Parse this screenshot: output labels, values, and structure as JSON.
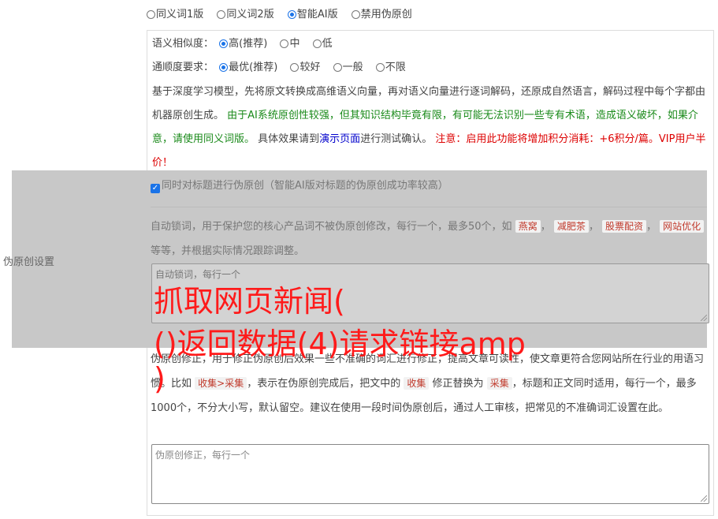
{
  "versions": {
    "selected": "智能AI版",
    "options": [
      "同义词1版",
      "同义词2版",
      "智能AI版",
      "禁用伪原创"
    ]
  },
  "similarity": {
    "label": "语义相似度：",
    "options": [
      "高(推荐)",
      "中",
      "低"
    ],
    "selected": "高(推荐)"
  },
  "fluency": {
    "label": "通顺度要求：",
    "options": [
      "最优(推荐)",
      "较好",
      "一般",
      "不限"
    ],
    "selected": "最优(推荐)"
  },
  "description": {
    "part1": "基于深度学习模型，先将原文转换成高维语义向量，再对语义向量进行逐词解码，还原成自然语言，解码过程中每个字都由机器原创生成。",
    "part2_green": "由于AI系统原创性较强，但其知识结构毕竟有限，有可能无法识别一些专有术语，造成语义破坏，如果介意，请使用同义词版。",
    "part3": "具体效果请到",
    "link": "演示页面",
    "part4": "进行测试确认。",
    "warning_red": "注意：启用此功能将增加积分消耗：+6积分/篇。VIP用户半价！"
  },
  "title_pseudo": {
    "label": "同时对标题进行伪原创（智能AI版对标题的伪原创成功率较高）",
    "checked": true
  },
  "side_label": "伪原创设置",
  "lock_words": {
    "text_before": "自动锁词，用于保护您的核心产品词不被伪原创修改，每行一个，最多50个，如",
    "tags": [
      "燕窝",
      "减肥茶",
      "股票配资",
      "网站优化"
    ],
    "text_after": "等等，并根据实际情况跟踪调整。",
    "placeholder": "自动锁词，每行一个"
  },
  "fix_words": {
    "text1": "伪原创修正，用于修正伪原创后效果一些不准确的词汇进行修正，提高文章可读性，使文章更符合您网站所在行业的用语习惯。比如",
    "tag1": "收集>采集",
    "text2": "，表示在伪原创完成后，把文中的",
    "tag2": "收集",
    "text3": "修正替换为",
    "tag3": "采集",
    "text4": "，标题和正文同时适用，每行一个，最多1000个，不分大小写，默认留空。建议在使用一段时间伪原创后，通过人工审核，把常见的不准确词汇设置在此。",
    "placeholder": "伪原创修正，每行一个"
  },
  "watermark": {
    "line1": "抓取网页新闻(",
    "line2": "()返回数据(4)请求链接amp",
    "line3": ")"
  }
}
